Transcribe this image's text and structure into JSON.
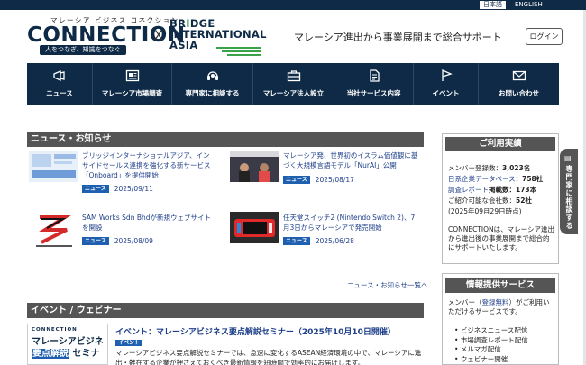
{
  "lang": {
    "ja": "日本語",
    "en": "ENGLISH"
  },
  "header": {
    "logo_small": "マレーシア ビジネス コネクション",
    "logo_big": "CONNECTION",
    "logo_tag": "人をつなぎ、知識をつなぐ",
    "logo_x": "X",
    "partner_line1_a": "BR",
    "partner_line1_b": "DGE",
    "partner_line1_o": "I",
    "partner_line2": "INTERNATIONAL",
    "partner_line3": "ASIA",
    "tagline": "マレーシア進出から事業展開まで総合サポート",
    "login": "ログイン"
  },
  "nav": [
    {
      "label": "ニュース",
      "icon": "megaphone-icon"
    },
    {
      "label": "マレーシア市場調査",
      "icon": "newspaper-icon"
    },
    {
      "label": "専門家に相談する",
      "icon": "headset-icon"
    },
    {
      "label": "マレーシア法人設立",
      "icon": "briefcase-icon"
    },
    {
      "label": "当社サービス内容",
      "icon": "document-icon"
    },
    {
      "label": "イベント",
      "icon": "flag-icon"
    },
    {
      "label": "お問い合わせ",
      "icon": "mail-icon"
    }
  ],
  "news": {
    "title": "ニュース・お知らせ",
    "badge": "ニュース",
    "more": "ニュース・お知らせ一覧へ",
    "items": [
      {
        "text": "ブリッジインターナショナルアジア、インサイドセールス連携を強化する新サービス「Onboard」を提供開始",
        "date": "2025/09/11"
      },
      {
        "text": "マレーシア発、世界初のイスラム価値観に基づく大規模言語モデル「NurAI」公開",
        "date": "2025/08/17"
      },
      {
        "text": "SAM Works Sdn Bhdが新規ウェブサイトを開設",
        "date": "2025/08/09"
      },
      {
        "text": "任天堂スイッチ2 (Nintendo Switch 2)、7月3日からマレーシアで発売開始",
        "date": "2025/06/28"
      }
    ]
  },
  "event": {
    "section_title": "イベント / ウェビナー",
    "thumb_line1": "CONNECTION",
    "thumb_line2": "マレーシアビジネス",
    "thumb_line3a": "要点解説",
    "thumb_line3b": " セミナー",
    "title": "イベント：マレーシアビジネス要点解説セミナー（2025年10月10日開催）",
    "badge": "イベント",
    "desc": "マレーシアビジネス要点解説セミナーでは、急速に変化するASEAN経済環境の中で、マレーシアに進出・難在する企業が押さえておくべき最新情報を短時間で効率的にお届けします。"
  },
  "sidebar": {
    "results_title": "ご利用実績",
    "members_label": "メンバー登録数：",
    "members_value": "3,023名",
    "db_label": "日系企業データベース",
    "db_value": "：758社",
    "reports_label": "調査レポート",
    "reports_value": "掲載数：173本",
    "intro_label": "ご紹介可能な会社数：",
    "intro_value": "52社",
    "as_of": "(2025年09月29日時点)",
    "desc": "CONNECTIONは、マレーシア進出から進出後の事業展開まで総合的にサポートいたします。",
    "services_title": "情報提供サービス",
    "services_desc_a": "メンバー（",
    "services_desc_link": "登録無料",
    "services_desc_b": "）がご利用いただけるサービスです。",
    "services": [
      "ビジネスニュース配信",
      "市場調査レポート配信",
      "メルマガ配信",
      "ウェビナー開催"
    ]
  },
  "vtab": {
    "icon": "▤",
    "text": "専門家に相談する"
  },
  "colors": {
    "navy": "#0e2a47",
    "link": "#1e3f8a",
    "badge": "#1e5fb0",
    "header_gray": "#555555",
    "green": "#3aa34a"
  }
}
